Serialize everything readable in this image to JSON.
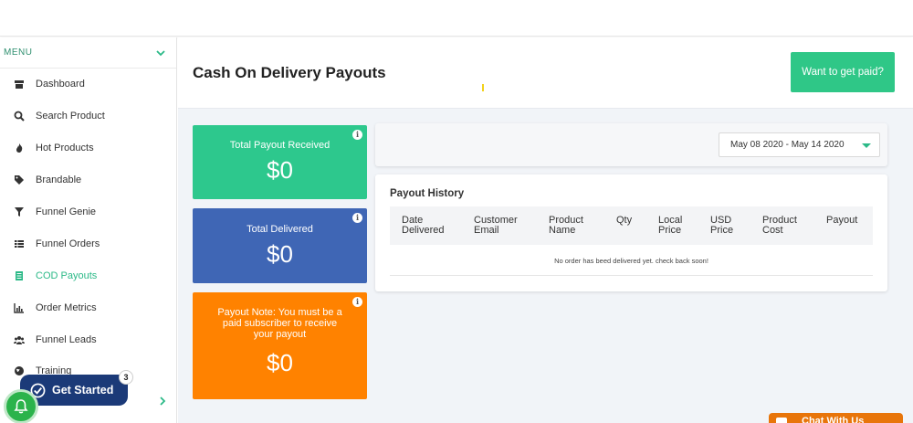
{
  "sidebar": {
    "menu_label": "MENU",
    "items": [
      {
        "label": "Dashboard",
        "icon": "store-icon"
      },
      {
        "label": "Search Product",
        "icon": "search-icon"
      },
      {
        "label": "Hot Products",
        "icon": "fire-icon"
      },
      {
        "label": "Brandable",
        "icon": "tags-icon"
      },
      {
        "label": "Funnel Genie",
        "icon": "filter-icon"
      },
      {
        "label": "Funnel Orders",
        "icon": "list-icon"
      },
      {
        "label": "COD Payouts",
        "icon": "document-icon",
        "active": true
      },
      {
        "label": "Order Metrics",
        "icon": "bar-chart-icon"
      },
      {
        "label": "Funnel Leads",
        "icon": "users-icon"
      },
      {
        "label": "Training",
        "icon": "globe-icon"
      }
    ]
  },
  "header": {
    "title": "Cash On Delivery Payouts",
    "cta_label": "Want to get paid?"
  },
  "stats": {
    "received": {
      "label": "Total Payout Received",
      "amount": "$0"
    },
    "delivered": {
      "label": "Total Delivered",
      "amount": "$0"
    },
    "payout": {
      "label": "Payout Note: You must be a paid subscriber to receive your payout",
      "amount": "$0"
    },
    "info_glyph": "i"
  },
  "date_range": {
    "value": "May 08 2020 - May 14 2020"
  },
  "payout_history": {
    "title": "Payout History",
    "columns": [
      "Date Delivered",
      "Customer Email",
      "Product Name",
      "Qty",
      "Local Price",
      "USD Price",
      "Product Cost",
      "Payout"
    ],
    "empty_message": "No order has beed delivered yet. check back soon!"
  },
  "widgets": {
    "get_started_label": "Get Started",
    "get_started_badge": "3",
    "chat_label": "Chat With Us"
  },
  "colors": {
    "accent": "#2bb987",
    "green_card": "#2dc88d",
    "blue_card": "#3f66b5",
    "orange_card": "#ff8200",
    "get_started": "#1b3a78"
  }
}
